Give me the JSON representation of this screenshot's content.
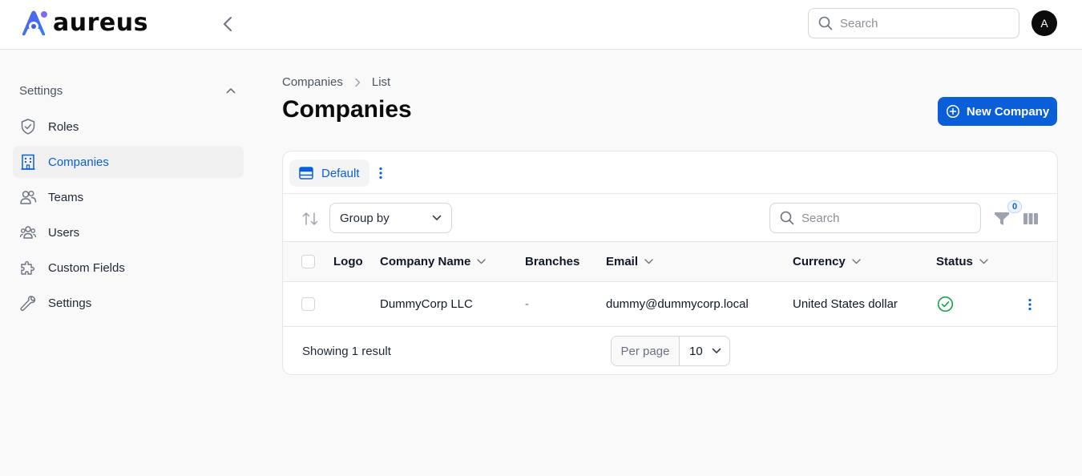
{
  "app": {
    "name": "aureus",
    "brand_color": "#0a5fd8"
  },
  "header": {
    "search_placeholder": "Search",
    "avatar_initial": "A"
  },
  "sidebar": {
    "group_label": "Settings",
    "items": [
      {
        "label": "Roles",
        "icon": "shield-check-icon",
        "active": false
      },
      {
        "label": "Companies",
        "icon": "building-icon",
        "active": true
      },
      {
        "label": "Teams",
        "icon": "users-icon",
        "active": false
      },
      {
        "label": "Users",
        "icon": "user-group-icon",
        "active": false
      },
      {
        "label": "Custom Fields",
        "icon": "puzzle-icon",
        "active": false
      },
      {
        "label": "Settings",
        "icon": "wrench-icon",
        "active": false
      }
    ]
  },
  "breadcrumb": {
    "items": [
      "Companies",
      "List"
    ]
  },
  "page": {
    "title": "Companies",
    "new_button_label": "New Company"
  },
  "table": {
    "view_tab_label": "Default",
    "group_by_label": "Group by",
    "search_placeholder": "Search",
    "filter_count": "0",
    "columns": [
      "Logo",
      "Company Name",
      "Branches",
      "Email",
      "Currency",
      "Status"
    ],
    "rows": [
      {
        "logo": "",
        "company_name": "DummyCorp LLC",
        "branches": "-",
        "email": "dummy@dummycorp.local",
        "currency": "United States dollar",
        "status": "active"
      }
    ],
    "footer": {
      "showing_text": "Showing 1 result",
      "per_page_label": "Per page",
      "per_page_value": "10"
    }
  },
  "colors": {
    "status_active": "#16a34a"
  }
}
